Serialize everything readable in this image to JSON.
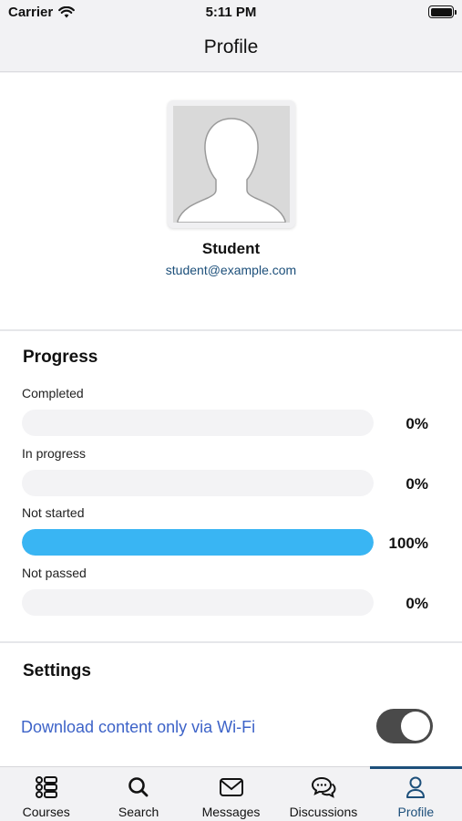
{
  "status_bar": {
    "carrier": "Carrier",
    "time": "5:11 PM"
  },
  "nav": {
    "title": "Profile"
  },
  "profile": {
    "name": "Student",
    "email": "student@example.com"
  },
  "progress": {
    "title": "Progress",
    "items": [
      {
        "label": "Completed",
        "value_text": "0%",
        "percent": 0
      },
      {
        "label": "In progress",
        "value_text": "0%",
        "percent": 0
      },
      {
        "label": "Not started",
        "value_text": "100%",
        "percent": 100
      },
      {
        "label": "Not passed",
        "value_text": "0%",
        "percent": 0
      }
    ],
    "fill_color": "#39b5f3"
  },
  "settings": {
    "title": "Settings",
    "wifi_only": {
      "label": "Download content only via Wi-Fi",
      "enabled": true
    }
  },
  "tabs": [
    {
      "label": "Courses",
      "icon": "courses-icon",
      "active": false
    },
    {
      "label": "Search",
      "icon": "search-icon",
      "active": false
    },
    {
      "label": "Messages",
      "icon": "mail-icon",
      "active": false
    },
    {
      "label": "Discussions",
      "icon": "discussions-icon",
      "active": false
    },
    {
      "label": "Profile",
      "icon": "person-icon",
      "active": true
    }
  ],
  "colors": {
    "accent": "#1c4f7a",
    "link": "#3d63c8",
    "toggle_on": "#4a4a4a"
  }
}
